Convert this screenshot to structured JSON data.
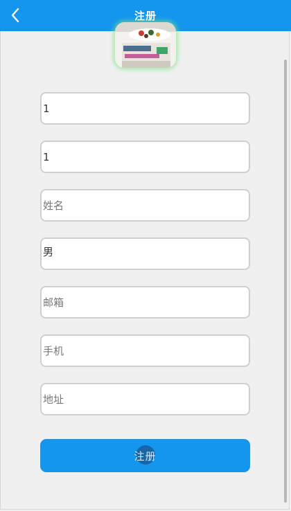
{
  "header": {
    "title": "注册",
    "back_icon": "chevron-left-icon",
    "background": "#1596ee"
  },
  "avatar": {
    "description_icon": "profile-photo"
  },
  "form": {
    "fields": [
      {
        "name": "username",
        "value": "1",
        "placeholder": ""
      },
      {
        "name": "password",
        "value": "1",
        "placeholder": ""
      },
      {
        "name": "realname",
        "value": "",
        "placeholder": "姓名"
      },
      {
        "name": "sex",
        "value": "男",
        "placeholder": ""
      },
      {
        "name": "email",
        "value": "",
        "placeholder": "邮箱"
      },
      {
        "name": "phone",
        "value": "",
        "placeholder": "手机"
      },
      {
        "name": "address",
        "value": "",
        "placeholder": "地址"
      }
    ],
    "submit_label": "注册"
  },
  "colors": {
    "accent": "#1596ee",
    "background": "#f0f0f0",
    "field_border": "#cfcfcf"
  }
}
